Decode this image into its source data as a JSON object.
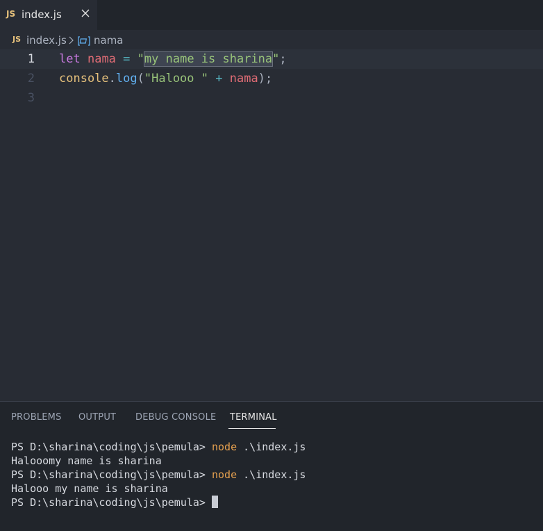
{
  "tab": {
    "icon_text": "JS",
    "label": "index.js"
  },
  "breadcrumb": {
    "icon_text": "JS",
    "file": "index.js",
    "symbol": "nama"
  },
  "editor": {
    "line_numbers": [
      "1",
      "2",
      "3"
    ],
    "line1": {
      "keyword": "let",
      "var": "nama",
      "op": "=",
      "quote_open": "\"",
      "string": "my name is sharina",
      "quote_close": "\"",
      "semi": ";"
    },
    "line2": {
      "obj": "console",
      "dot": ".",
      "fn": "log",
      "paren_open": "(",
      "string": "\"Halooo \"",
      "op": "+",
      "var": "nama",
      "paren_close": ");"
    }
  },
  "panel": {
    "tabs": [
      "PROBLEMS",
      "OUTPUT",
      "DEBUG CONSOLE",
      "TERMINAL"
    ],
    "active_tab": "TERMINAL"
  },
  "terminal": {
    "prompt": "PS D:\\sharina\\coding\\js\\pemula> ",
    "command": "node",
    "args": " .\\index.js",
    "output1": "Halooomy name is sharina",
    "output2": "Halooo my name is sharina"
  },
  "colors": {
    "background": "#282c34",
    "keyword": "#c678dd",
    "variable": "#e06c75",
    "string": "#98c379",
    "function": "#61afef",
    "js_badge": "#e5c07b"
  }
}
